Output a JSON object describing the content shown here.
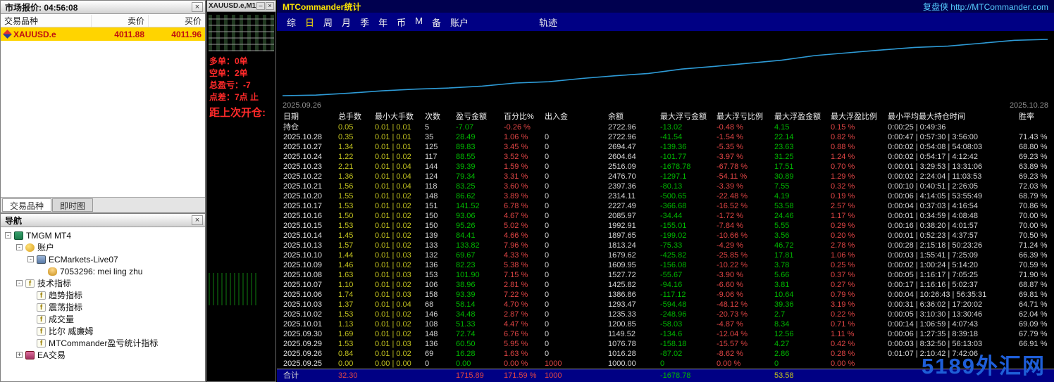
{
  "colors": {
    "accent_line": "#2e9bd6",
    "up_green": "#00b800",
    "down_red": "#e04545",
    "lots_yellow": "#c2c21f",
    "title_yellow": "#ffe600",
    "link_cyan": "#55ccff",
    "watermark_blue": "#1e5ed8",
    "quote_yellow": "#ffd400",
    "quote_red": "#c01010",
    "signal_red": "#ff2a2a"
  },
  "market_watch": {
    "title": "市场报价: 04:56:08",
    "columns": [
      "交易品种",
      "卖价",
      "买价"
    ],
    "symbol_row": {
      "symbol": "XAUUSD.e",
      "bid": "4011.88",
      "ask": "4011.96"
    },
    "tabs": [
      {
        "label": "交易品种",
        "active": true
      },
      {
        "label": "即时图",
        "active": false
      }
    ]
  },
  "navigator": {
    "title": "导航",
    "tree": [
      {
        "label": "TMGM MT4",
        "level": 0,
        "icon": "book-icon",
        "expander": "-"
      },
      {
        "label": "账户",
        "level": 1,
        "icon": "accounts-icon",
        "expander": "-"
      },
      {
        "label": "ECMarkets-Live07",
        "level": 2,
        "icon": "server-icon",
        "expander": "-"
      },
      {
        "label": "7053296: mei ling zhu",
        "level": 3,
        "icon": "user-icon",
        "expander": null
      },
      {
        "label": "技术指标",
        "level": 1,
        "icon": "indicator-icon",
        "expander": "-"
      },
      {
        "label": "趋势指标",
        "level": 2,
        "icon": "indicator-icon",
        "expander": null
      },
      {
        "label": "震荡指标",
        "level": 2,
        "icon": "indicator-icon",
        "expander": null
      },
      {
        "label": "成交量",
        "level": 2,
        "icon": "indicator-icon",
        "expander": null
      },
      {
        "label": "比尔 威廉姆",
        "level": 2,
        "icon": "indicator-icon",
        "expander": null
      },
      {
        "label": "MTCommander盈亏统计指标",
        "level": 2,
        "icon": "indicator-icon",
        "expander": null
      },
      {
        "label": "EA交易",
        "level": 1,
        "icon": "ea-icon",
        "expander": "+"
      }
    ]
  },
  "chart_window": {
    "title": "XAUUSD.e,M1",
    "overlay_lines": [
      "多单：0单",
      "空单：2单",
      "总盈亏：-7",
      "点差：7点 止",
      "距上次开仓:"
    ]
  },
  "stats_panel": {
    "title": "MTCommander统计",
    "title_right": "复盘侠 http://MTCommander.com",
    "menu_items": [
      "综",
      "日",
      "周",
      "月",
      "季",
      "年",
      "币",
      "M",
      "备",
      "账户"
    ],
    "active_menu_index": 1,
    "menu_right": "轨迹",
    "chart_label_left": "2025.09.26",
    "chart_label_right": "2025.10.28"
  },
  "chart_data": {
    "type": "line",
    "title": "账户余额曲线",
    "xlabel": "",
    "ylabel": "余额",
    "grid": "off",
    "legend": "off",
    "line_color": "#2e9bd6",
    "x": [
      "2025.09.25",
      "2025.09.26",
      "2025.09.29",
      "2025.09.30",
      "2025.10.01",
      "2025.10.02",
      "2025.10.03",
      "2025.10.06",
      "2025.10.07",
      "2025.10.08",
      "2025.10.09",
      "2025.10.10",
      "2025.10.13",
      "2025.10.14",
      "2025.10.15",
      "2025.10.16",
      "2025.10.17",
      "2025.10.20",
      "2025.10.21",
      "2025.10.22",
      "2025.10.23",
      "2025.10.24",
      "2025.10.27",
      "2025.10.28"
    ],
    "series": [
      {
        "name": "余额",
        "values": [
          1000.0,
          1016.28,
          1076.78,
          1149.52,
          1200.85,
          1235.33,
          1293.47,
          1386.86,
          1425.82,
          1527.72,
          1609.95,
          1679.62,
          1813.24,
          1897.65,
          1992.91,
          2085.97,
          2227.49,
          2314.11,
          2397.36,
          2476.7,
          2516.09,
          2604.64,
          2694.47,
          2722.96
        ]
      }
    ],
    "ylim": [
      1000,
      2722.96
    ],
    "x_axis_labels_shown": [
      "2025.09.26",
      "2025.10.28"
    ]
  },
  "stats_table": {
    "headers": [
      "日期",
      "总手数",
      "最小大手数",
      "次数",
      "盈亏金额",
      "百分比%",
      "出入金",
      "余额",
      "最大浮亏金额",
      "最大浮亏比例",
      "最大浮盈金额",
      "最大浮盈比例",
      "最小平均最大持仓时间",
      "胜率"
    ],
    "rows": [
      {
        "date": "持仓",
        "lots": "0.05",
        "minmax": "0.01 | 0.01",
        "count": "5",
        "pl": "-7.07",
        "pct": "-0.26 %",
        "inout": "",
        "balance": "2722.96",
        "dd": "-13.02",
        "dd_pct": "-0.48 %",
        "fp": "4.15",
        "fp_pct": "0.15 %",
        "time": "0:00:25 | 0:49:36",
        "win": ""
      },
      {
        "date": "2025.10.28",
        "lots": "0.35",
        "minmax": "0.01 | 0.01",
        "count": "35",
        "pl": "28.49",
        "pct": "1.06 %",
        "inout": "0",
        "balance": "2722.96",
        "dd": "-41.54",
        "dd_pct": "-1.54 %",
        "fp": "22.14",
        "fp_pct": "0.82 %",
        "time": "0:00:47 | 0:57:30 | 3:56:00",
        "win": "71.43 %"
      },
      {
        "date": "2025.10.27",
        "lots": "1.34",
        "minmax": "0.01 | 0.01",
        "count": "125",
        "pl": "89.83",
        "pct": "3.45 %",
        "inout": "0",
        "balance": "2694.47",
        "dd": "-139.36",
        "dd_pct": "-5.35 %",
        "fp": "23.63",
        "fp_pct": "0.88 %",
        "time": "0:00:02 | 0:54:08 | 54:08:03",
        "win": "68.80 %"
      },
      {
        "date": "2025.10.24",
        "lots": "1.22",
        "minmax": "0.01 | 0.02",
        "count": "117",
        "pl": "88.55",
        "pct": "3.52 %",
        "inout": "0",
        "balance": "2604.64",
        "dd": "-101.77",
        "dd_pct": "-3.97 %",
        "fp": "31.25",
        "fp_pct": "1.24 %",
        "time": "0:00:02 | 0:54:17 | 4:12:42",
        "win": "69.23 %"
      },
      {
        "date": "2025.10.23",
        "lots": "2.21",
        "minmax": "0.01 | 0.04",
        "count": "144",
        "pl": "39.39",
        "pct": "1.59 %",
        "inout": "0",
        "balance": "2516.09",
        "dd": "-1678.78",
        "dd_pct": "-67.78 %",
        "fp": "17.51",
        "fp_pct": "0.70 %",
        "time": "0:00:01 | 3:29:53 | 13:31:06",
        "win": "63.89 %"
      },
      {
        "date": "2025.10.22",
        "lots": "1.36",
        "minmax": "0.01 | 0.04",
        "count": "124",
        "pl": "79.34",
        "pct": "3.31 %",
        "inout": "0",
        "balance": "2476.70",
        "dd": "-1297.1",
        "dd_pct": "-54.11 %",
        "fp": "30.89",
        "fp_pct": "1.29 %",
        "time": "0:00:02 | 2:24:04 | 11:03:53",
        "win": "69.23 %"
      },
      {
        "date": "2025.10.21",
        "lots": "1.56",
        "minmax": "0.01 | 0.04",
        "count": "118",
        "pl": "83.25",
        "pct": "3.60 %",
        "inout": "0",
        "balance": "2397.36",
        "dd": "-80.13",
        "dd_pct": "-3.39 %",
        "fp": "7.55",
        "fp_pct": "0.32 %",
        "time": "0:00:10 | 0:40:51 | 2:26:05",
        "win": "72.03 %"
      },
      {
        "date": "2025.10.20",
        "lots": "1.55",
        "minmax": "0.01 | 0.02",
        "count": "148",
        "pl": "86.62",
        "pct": "3.89 %",
        "inout": "0",
        "balance": "2314.11",
        "dd": "-500.65",
        "dd_pct": "-22.48 %",
        "fp": "4.19",
        "fp_pct": "0.19 %",
        "time": "0:00:06 | 4:14:05 | 53:55:49",
        "win": "68.79 %"
      },
      {
        "date": "2025.10.17",
        "lots": "1.53",
        "minmax": "0.01 | 0.02",
        "count": "151",
        "pl": "141.52",
        "pct": "6.78 %",
        "inout": "0",
        "balance": "2227.49",
        "dd": "-366.68",
        "dd_pct": "-16.52 %",
        "fp": "53.58",
        "fp_pct": "2.57 %",
        "time": "0:00:04 | 0:37:03 | 4:16:54",
        "win": "70.86 %"
      },
      {
        "date": "2025.10.16",
        "lots": "1.50",
        "minmax": "0.01 | 0.02",
        "count": "150",
        "pl": "93.06",
        "pct": "4.67 %",
        "inout": "0",
        "balance": "2085.97",
        "dd": "-34.44",
        "dd_pct": "-1.72 %",
        "fp": "24.46",
        "fp_pct": "1.17 %",
        "time": "0:00:01 | 0:34:59 | 4:08:48",
        "win": "70.00 %"
      },
      {
        "date": "2025.10.15",
        "lots": "1.53",
        "minmax": "0.01 | 0.02",
        "count": "150",
        "pl": "95.26",
        "pct": "5.02 %",
        "inout": "0",
        "balance": "1992.91",
        "dd": "-155.01",
        "dd_pct": "-7.84 %",
        "fp": "5.55",
        "fp_pct": "0.29 %",
        "time": "0:00:16 | 0:38:20 | 4:01:57",
        "win": "70.00 %"
      },
      {
        "date": "2025.10.14",
        "lots": "1.45",
        "minmax": "0.01 | 0.02",
        "count": "139",
        "pl": "84.41",
        "pct": "4.66 %",
        "inout": "0",
        "balance": "1897.65",
        "dd": "-199.02",
        "dd_pct": "-10.66 %",
        "fp": "3.56",
        "fp_pct": "0.20 %",
        "time": "0:00:01 | 0:52:23 | 4:37:57",
        "win": "70.50 %"
      },
      {
        "date": "2025.10.13",
        "lots": "1.57",
        "minmax": "0.01 | 0.02",
        "count": "133",
        "pl": "133.82",
        "pct": "7.96 %",
        "inout": "0",
        "balance": "1813.24",
        "dd": "-75.33",
        "dd_pct": "-4.29 %",
        "fp": "46.72",
        "fp_pct": "2.78 %",
        "time": "0:00:28 | 2:15:18 | 50:23:26",
        "win": "71.24 %"
      },
      {
        "date": "2025.10.10",
        "lots": "1.44",
        "minmax": "0.01 | 0.03",
        "count": "132",
        "pl": "69.67",
        "pct": "4.33 %",
        "inout": "0",
        "balance": "1679.62",
        "dd": "-425.82",
        "dd_pct": "-25.85 %",
        "fp": "17.81",
        "fp_pct": "1.06 %",
        "time": "0:00:03 | 1:55:41 | 7:25:09",
        "win": "66.39 %"
      },
      {
        "date": "2025.10.09",
        "lots": "1.46",
        "minmax": "0.01 | 0.02",
        "count": "136",
        "pl": "82.23",
        "pct": "5.38 %",
        "inout": "0",
        "balance": "1609.95",
        "dd": "-156.08",
        "dd_pct": "-10.22 %",
        "fp": "3.78",
        "fp_pct": "0.25 %",
        "time": "0:00:02 | 1:00:24 | 5:14:20",
        "win": "70.59 %"
      },
      {
        "date": "2025.10.08",
        "lots": "1.63",
        "minmax": "0.01 | 0.03",
        "count": "153",
        "pl": "101.90",
        "pct": "7.15 %",
        "inout": "0",
        "balance": "1527.72",
        "dd": "-55.67",
        "dd_pct": "-3.90 %",
        "fp": "5.66",
        "fp_pct": "0.37 %",
        "time": "0:00:05 | 1:16:17 | 7:05:25",
        "win": "71.90 %"
      },
      {
        "date": "2025.10.07",
        "lots": "1.10",
        "minmax": "0.01 | 0.02",
        "count": "106",
        "pl": "38.96",
        "pct": "2.81 %",
        "inout": "0",
        "balance": "1425.82",
        "dd": "-94.16",
        "dd_pct": "-6.60 %",
        "fp": "3.81",
        "fp_pct": "0.27 %",
        "time": "0:00:17 | 1:16:16 | 5:02:37",
        "win": "68.87 %"
      },
      {
        "date": "2025.10.06",
        "lots": "1.74",
        "minmax": "0.01 | 0.03",
        "count": "158",
        "pl": "93.39",
        "pct": "7.22 %",
        "inout": "0",
        "balance": "1386.86",
        "dd": "-117.12",
        "dd_pct": "-9.06 %",
        "fp": "10.64",
        "fp_pct": "0.79 %",
        "time": "0:00:04 | 10:26:43 | 56:35:31",
        "win": "69.81 %"
      },
      {
        "date": "2025.10.03",
        "lots": "1.37",
        "minmax": "0.01 | 0.04",
        "count": "68",
        "pl": "58.14",
        "pct": "4.70 %",
        "inout": "0",
        "balance": "1293.47",
        "dd": "-594.48",
        "dd_pct": "-48.12 %",
        "fp": "39.36",
        "fp_pct": "3.19 %",
        "time": "0:00:31 | 6:36:02 | 17:20:02",
        "win": "64.71 %"
      },
      {
        "date": "2025.10.02",
        "lots": "1.53",
        "minmax": "0.01 | 0.02",
        "count": "146",
        "pl": "34.48",
        "pct": "2.87 %",
        "inout": "0",
        "balance": "1235.33",
        "dd": "-248.96",
        "dd_pct": "-20.73 %",
        "fp": "2.7",
        "fp_pct": "0.22 %",
        "time": "0:00:05 | 3:10:30 | 13:30:46",
        "win": "62.04 %"
      },
      {
        "date": "2025.10.01",
        "lots": "1.13",
        "minmax": "0.01 | 0.02",
        "count": "108",
        "pl": "51.33",
        "pct": "4.47 %",
        "inout": "0",
        "balance": "1200.85",
        "dd": "-58.03",
        "dd_pct": "-4.87 %",
        "fp": "8.34",
        "fp_pct": "0.71 %",
        "time": "0:00:14 | 1:06:59 | 4:07:43",
        "win": "69.09 %"
      },
      {
        "date": "2025.09.30",
        "lots": "1.69",
        "minmax": "0.01 | 0.02",
        "count": "148",
        "pl": "72.74",
        "pct": "6.76 %",
        "inout": "0",
        "balance": "1149.52",
        "dd": "-134.6",
        "dd_pct": "-12.04 %",
        "fp": "12.56",
        "fp_pct": "1.11 %",
        "time": "0:00:06 | 1:27:35 | 8:39:18",
        "win": "67.79 %"
      },
      {
        "date": "2025.09.29",
        "lots": "1.53",
        "minmax": "0.01 | 0.03",
        "count": "136",
        "pl": "60.50",
        "pct": "5.95 %",
        "inout": "0",
        "balance": "1076.78",
        "dd": "-158.18",
        "dd_pct": "-15.57 %",
        "fp": "4.27",
        "fp_pct": "0.42 %",
        "time": "0:00:03 | 8:32:50 | 56:13:03",
        "win": "66.91 %"
      },
      {
        "date": "2025.09.26",
        "lots": "0.84",
        "minmax": "0.01 | 0.02",
        "count": "69",
        "pl": "16.28",
        "pct": "1.63 %",
        "inout": "0",
        "balance": "1016.28",
        "dd": "-87.02",
        "dd_pct": "-8.62 %",
        "fp": "2.86",
        "fp_pct": "0.28 %",
        "time": "0:01:07 | 2:10:42 | 7:42:06",
        "win": ""
      },
      {
        "date": "2025.09.25",
        "lots": "0.00",
        "minmax": "0.00 | 0.00",
        "count": "0",
        "pl": "0.00",
        "pct": "0.00 %",
        "inout": "1000",
        "balance": "1000.00",
        "dd": "0",
        "dd_pct": "0.00 %",
        "fp": "0",
        "fp_pct": "0.00 %",
        "time": "",
        "win": ""
      }
    ],
    "total": {
      "date": "合计",
      "lots": "32.30",
      "minmax": "",
      "count": "",
      "pl": "1715.89",
      "pct": "171.59 %",
      "inout": "1000",
      "balance": "",
      "dd": "-1678.78",
      "dd_pct": "",
      "fp": "53.58",
      "fp_pct": "",
      "time": "",
      "win": ""
    }
  },
  "watermark": "5189外汇网"
}
